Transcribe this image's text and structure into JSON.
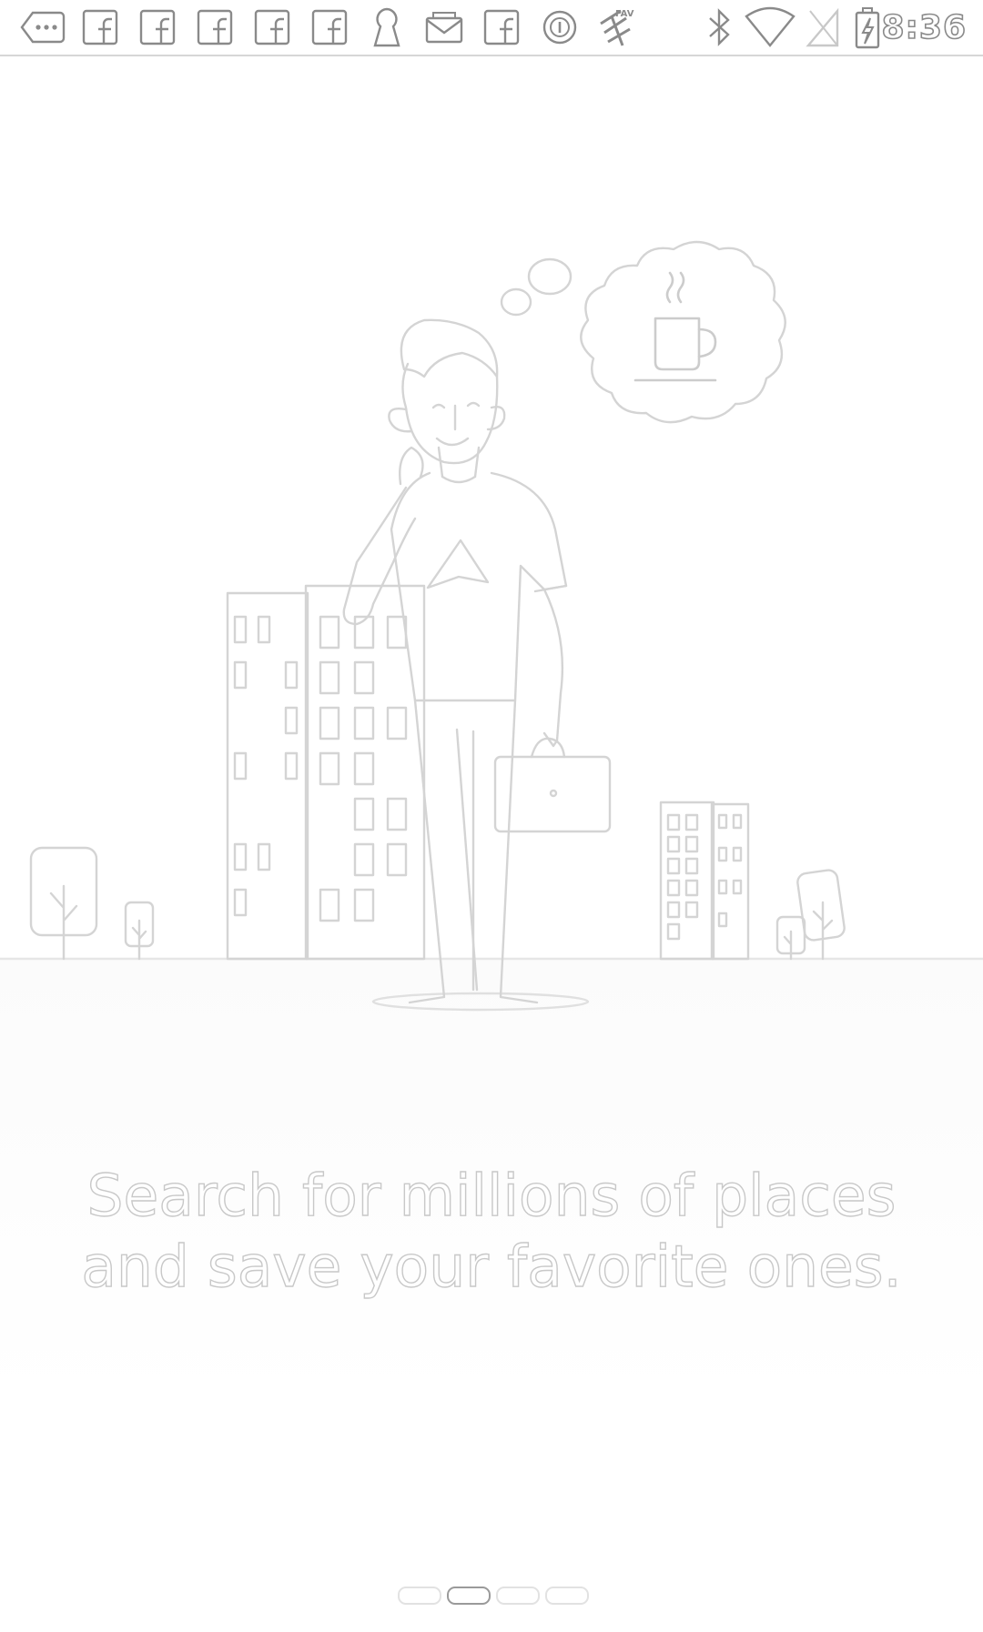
{
  "status_bar": {
    "time": "8:36",
    "left_icons": [
      "more-notifications-icon",
      "facebook-icon",
      "facebook-icon",
      "facebook-icon",
      "facebook-icon",
      "facebook-icon",
      "keyhole-icon",
      "mail-icon",
      "facebook-icon",
      "circle-app-icon",
      "fav-app-icon"
    ],
    "right_icons": [
      "bluetooth-icon",
      "wifi-icon",
      "no-sim-icon",
      "battery-charging-icon"
    ]
  },
  "onboarding": {
    "tagline_line1": "Search for millions of places",
    "tagline_line2": "and save your favorite ones.",
    "page_count": 4,
    "active_page": 2
  }
}
